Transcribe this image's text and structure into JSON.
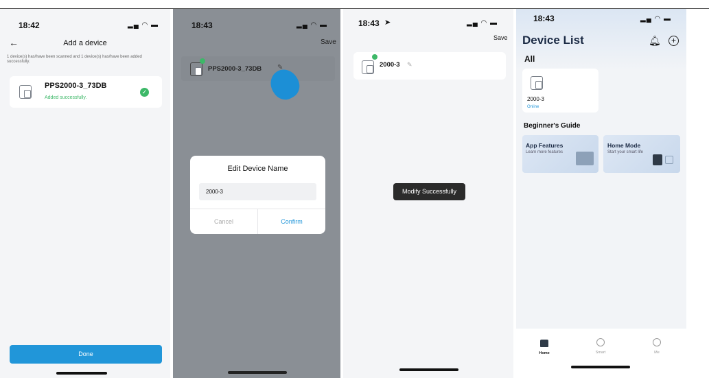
{
  "colors": {
    "accent": "#2196d9",
    "success": "#3db868",
    "toast_bg": "#2b2b2b"
  },
  "screen1": {
    "time": "18:42",
    "status_icons": "▂▄ ◠ ▬",
    "title": "Add a device",
    "back_icon": "←",
    "info_text": "1 device(s) has/have been scanned and 1 device(s) has/have been added successfully.",
    "device_name": "PPS2000-3_73DB",
    "device_status": "Added successfully.",
    "done_label": "Done"
  },
  "screen2": {
    "time": "18:43",
    "status_icons": "▂▄ ◠ ▬",
    "save_label": "Save",
    "device_name": "PPS2000-3_73DB",
    "dialog_title": "Edit Device Name",
    "dialog_value": "2000-3",
    "cancel_label": "Cancel",
    "confirm_label": "Confirm"
  },
  "screen3": {
    "time": "18:43",
    "status_icons": "▂▄ ◠ ▬",
    "save_label": "Save",
    "device_name": "2000-3",
    "toast": "Modify Successfully"
  },
  "screen4": {
    "time": "18:43",
    "status_icons": "▂▄ ◠ ▬",
    "title": "Device List",
    "section_all": "All",
    "device_name": "2000-3",
    "device_status": "Online",
    "guide_title": "Beginner's Guide",
    "guide_cards": [
      {
        "title": "App Features",
        "subtitle": "Learn more features"
      },
      {
        "title": "Home Mode",
        "subtitle": "Start your smart life"
      }
    ],
    "nav": [
      {
        "label": "Home"
      },
      {
        "label": "Smart"
      },
      {
        "label": "Me"
      }
    ]
  }
}
